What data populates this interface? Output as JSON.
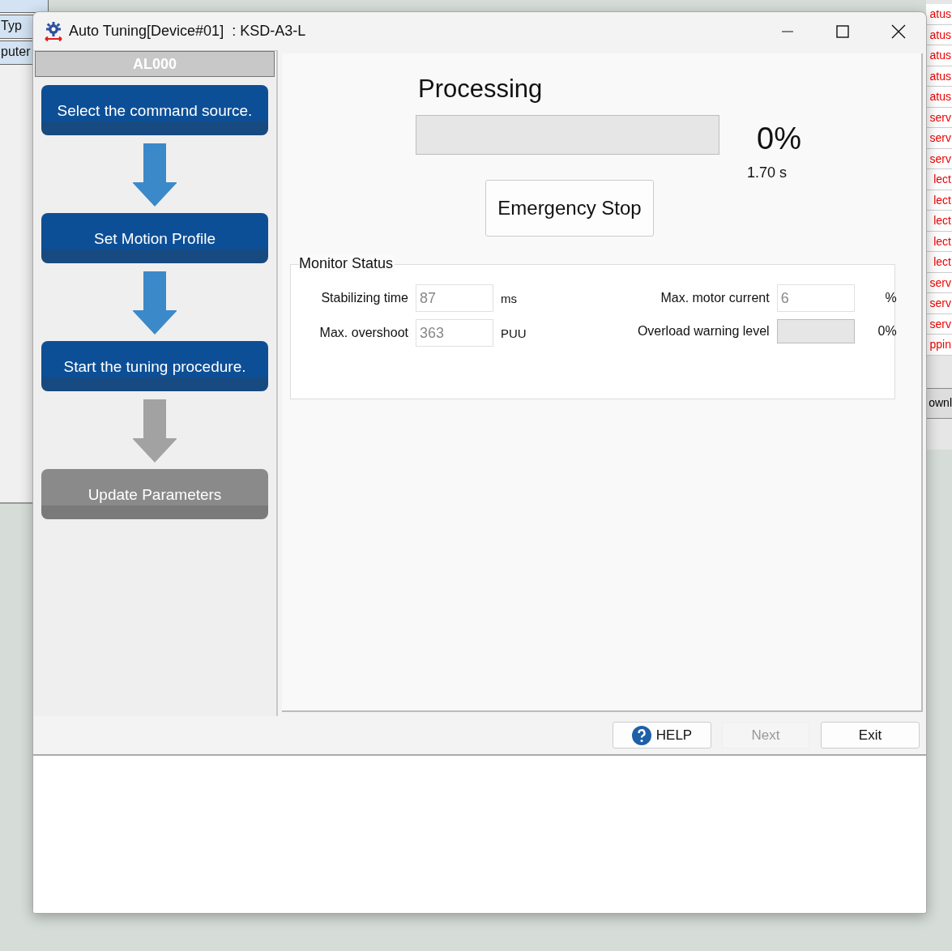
{
  "background_app": {
    "left_items": [
      "Typ",
      "puter"
    ],
    "right_column": [
      "atus",
      "atus",
      "atus",
      "atus",
      "atus",
      "serv",
      "serv",
      "serv",
      "lect",
      "lect",
      "lect",
      "lect",
      "lect",
      "serv",
      "serv",
      "serv",
      "ppin"
    ],
    "right_button": "ownl"
  },
  "window": {
    "title": "Auto Tuning[Device#01]  : KSD-A3-L"
  },
  "alarm": "AL000",
  "steps": [
    {
      "label": "Select the command source.",
      "active": true
    },
    {
      "label": "Set Motion Profile",
      "active": true
    },
    {
      "label": "Start the tuning procedure.",
      "active": true
    },
    {
      "label": "Update Parameters",
      "active": false
    }
  ],
  "progress": {
    "title": "Processing",
    "level": 0,
    "percent": "0%",
    "elapsed": "1.70 s"
  },
  "emergency_button": "Emergency Stop",
  "monitor": {
    "title": "Monitor Status",
    "left": [
      {
        "label": "Stabilizing time",
        "value": "87",
        "unit": "ms"
      },
      {
        "label": "Max. overshoot",
        "value": "363",
        "unit": "PUU"
      }
    ],
    "max_current": {
      "label": "Max. motor current",
      "value": "6",
      "unit": "%"
    },
    "overload": {
      "label": "Overload warning level",
      "level": 0,
      "reading": "0%"
    }
  },
  "buttons": [
    {
      "label": "HELP",
      "kind": "help",
      "disabled": false
    },
    {
      "label": "Next",
      "kind": "plain",
      "disabled": true
    },
    {
      "label": "Exit",
      "kind": "plain",
      "disabled": false
    }
  ]
}
